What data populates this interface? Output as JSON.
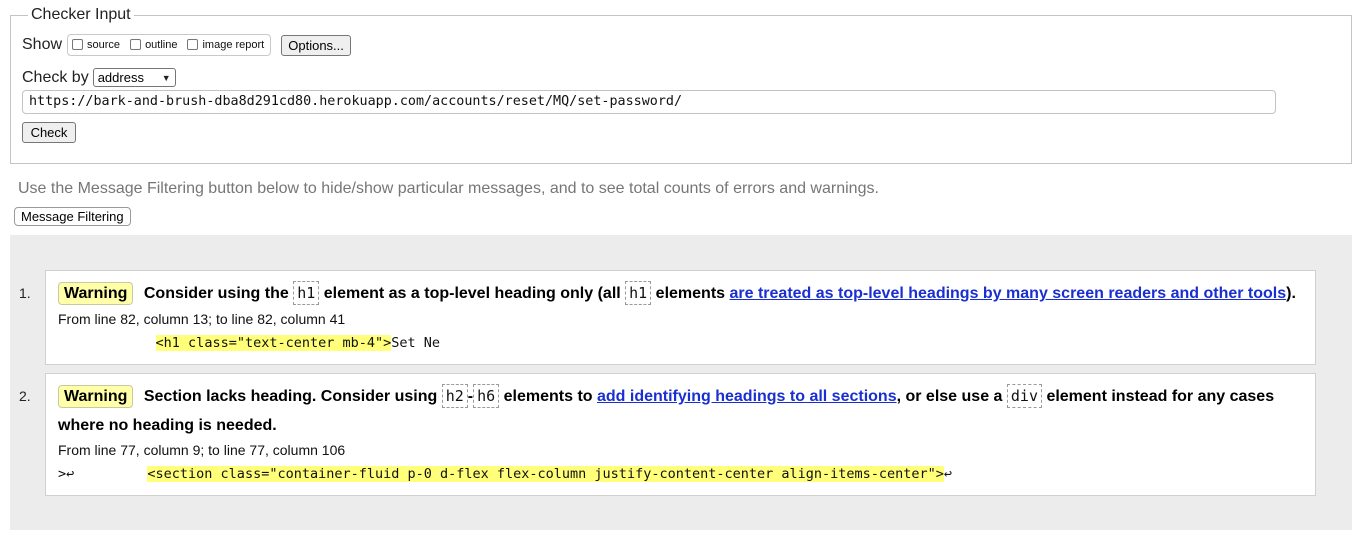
{
  "checker": {
    "legend": "Checker Input",
    "show_label": "Show",
    "options": [
      {
        "label": "source",
        "checked": false
      },
      {
        "label": "outline",
        "checked": false
      },
      {
        "label": "image report",
        "checked": false
      }
    ],
    "options_button": "Options...",
    "check_by_label": "Check by",
    "check_by_value": "address",
    "url_value": "https://bark-and-brush-dba8d291cd80.herokuapp.com/accounts/reset/MQ/set-password/",
    "check_button": "Check"
  },
  "filter": {
    "note": "Use the Message Filtering button below to hide/show particular messages, and to see total counts of errors and warnings.",
    "button": "Message Filtering"
  },
  "messages": [
    {
      "number": "1.",
      "type": "Warning",
      "text_1": "Consider using the",
      "code_1": "h1",
      "text_2": "element as a top-level heading only (all",
      "code_2": "h1",
      "text_3": "elements",
      "link": "are treated as top-level headings by many screen readers and other tools",
      "text_4": ").",
      "location": "From line 82, column 13; to line 82, column 41",
      "extract_prefix": "",
      "extract_highlight": "<h1 class=\"text-center mb-4\">",
      "extract_suffix": "Set Ne"
    },
    {
      "number": "2.",
      "type": "Warning",
      "text_1": "Section lacks heading. Consider using",
      "code_1": "h2",
      "dash": "-",
      "code_2": "h6",
      "text_2": "elements to",
      "link": "add identifying headings to all sections",
      "text_3": ", or else use a",
      "code_3": "div",
      "text_4": "element instead for any cases where no heading is needed.",
      "location": "From line 77, column 9; to line 77, column 106",
      "extract_prefix": ">↩         ",
      "extract_highlight": "<section class=\"container-fluid p-0 d-flex flex-column justify-content-center align-items-center\">",
      "extract_suffix": "↩"
    }
  ]
}
